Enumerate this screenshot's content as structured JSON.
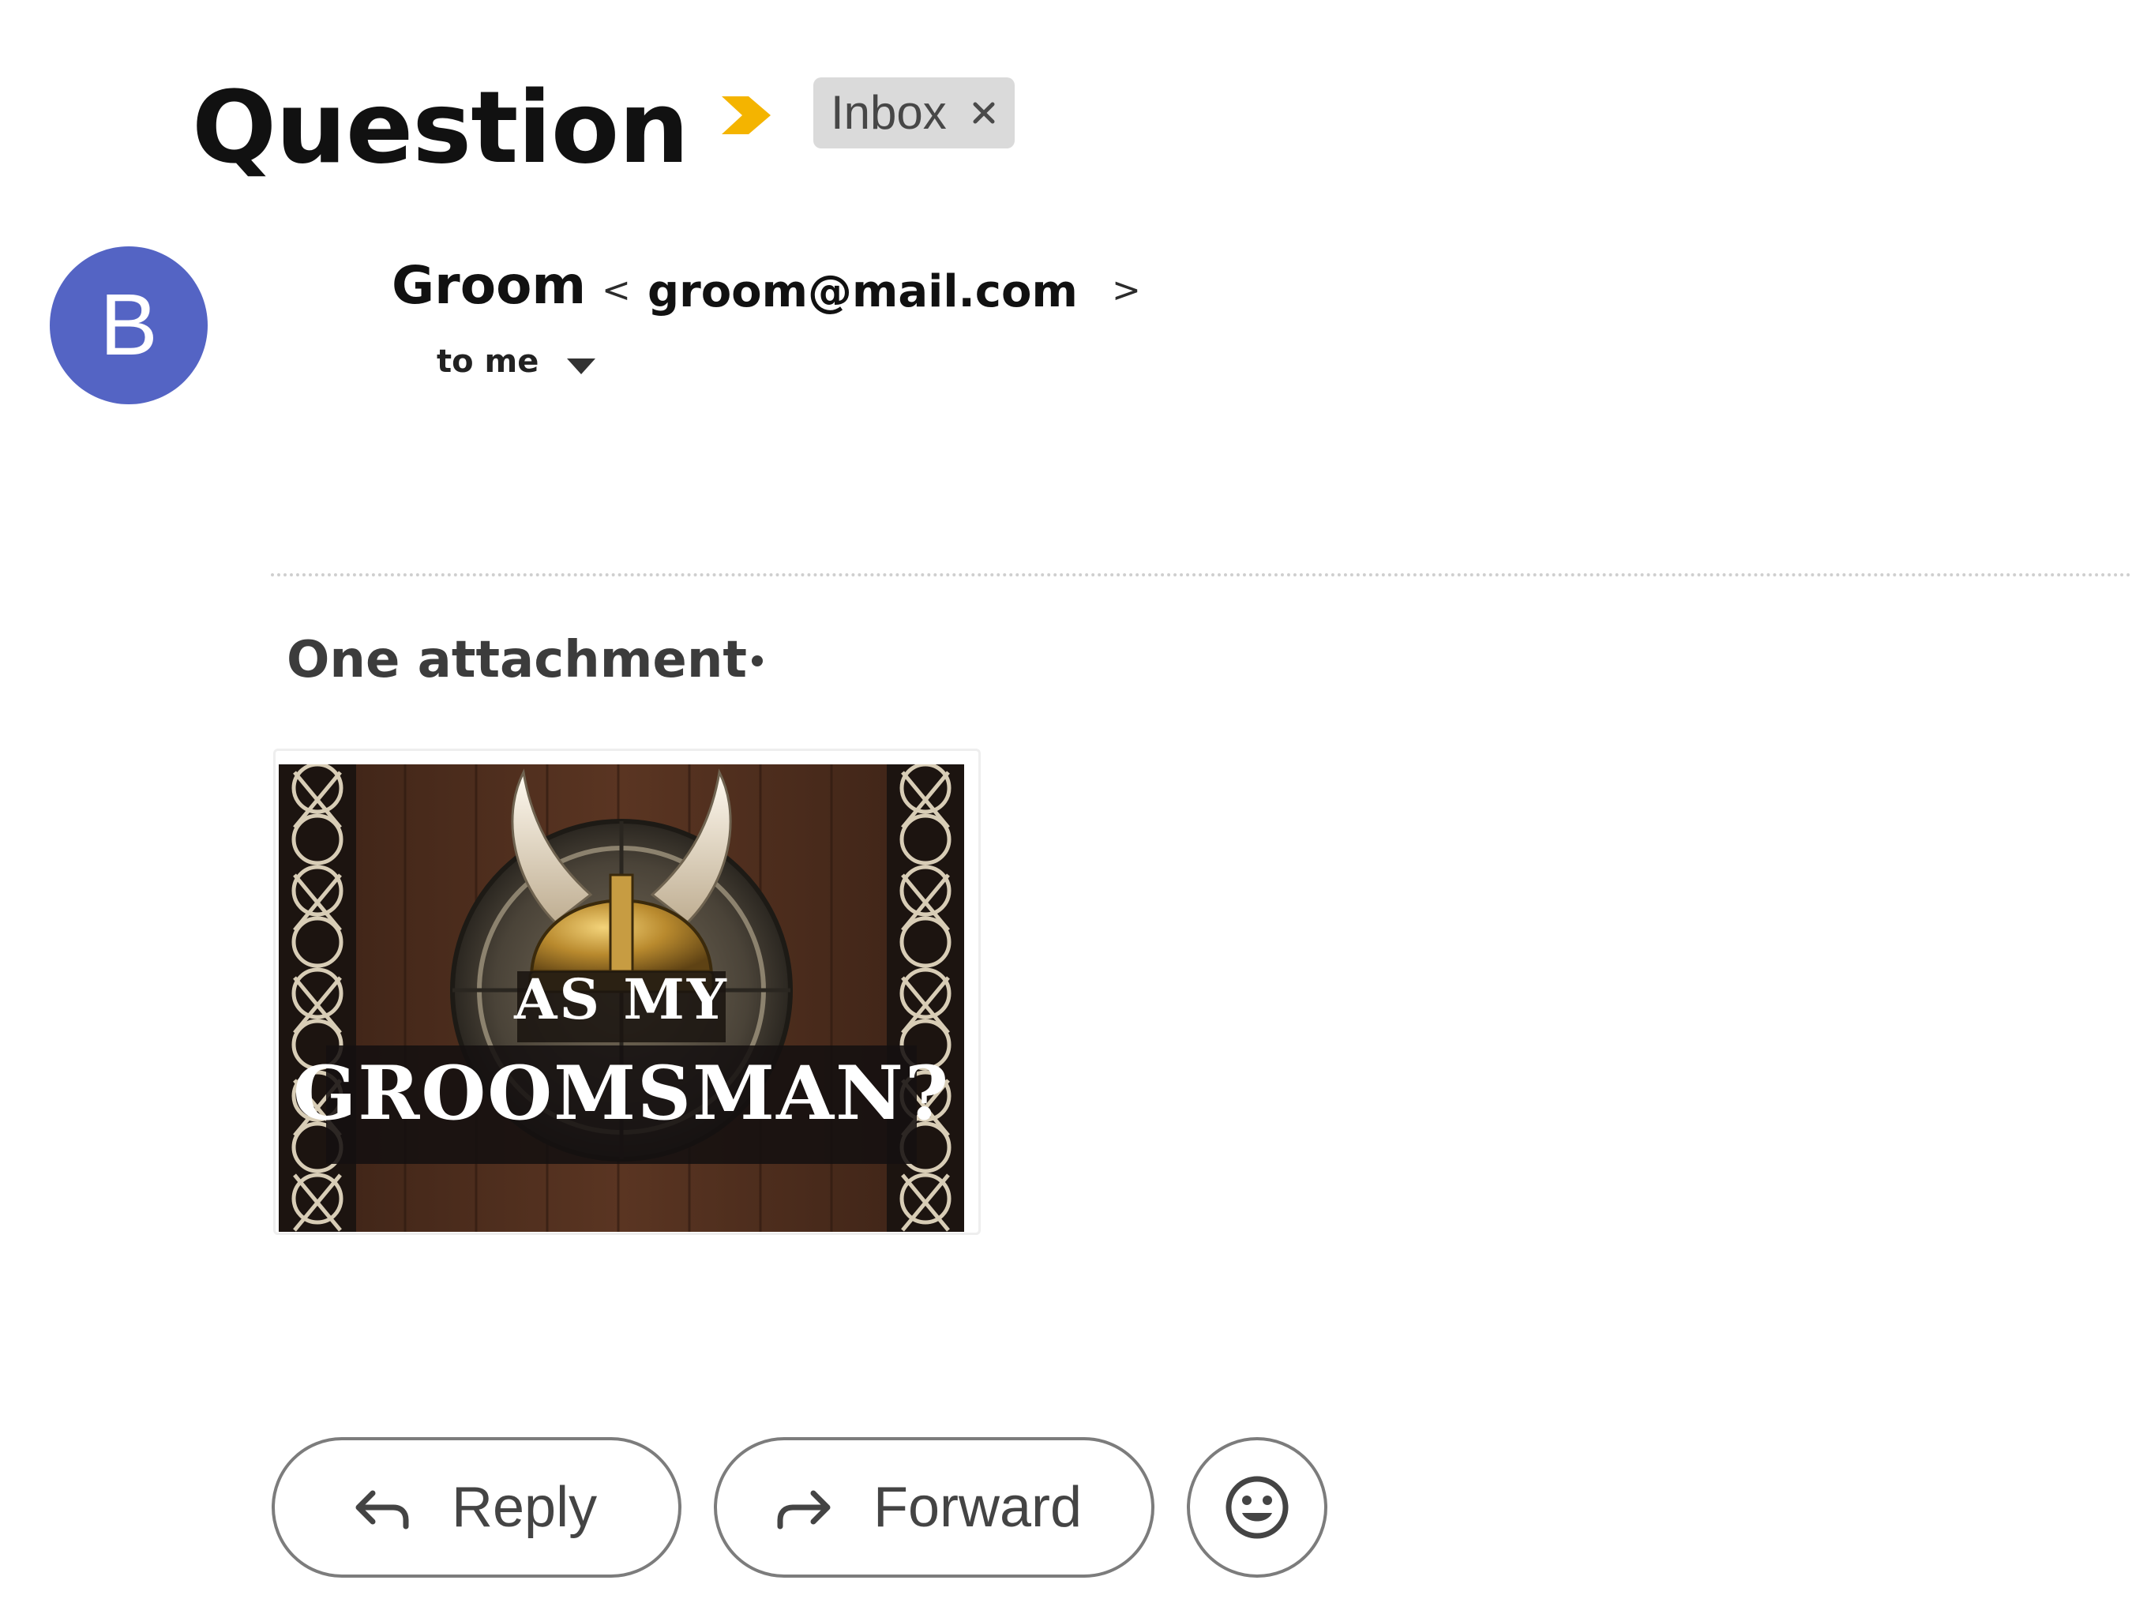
{
  "email": {
    "subject": "Question",
    "label": "Inbox",
    "importance_icon": "importance-arrow-icon",
    "accent_color": "#f4b400"
  },
  "sender": {
    "avatar_letter": "B",
    "avatar_color": "#5464c4",
    "name": "Groom",
    "angle_open": "<",
    "email": "groom@mail.com",
    "angle_close": ">",
    "recipient": "to me"
  },
  "attachments": {
    "header": "One attachment",
    "separator": "•",
    "items": [
      {
        "caption_line1": "AS MY",
        "caption_line2": "GROOMSMAN?"
      }
    ]
  },
  "actions": {
    "reply_label": "Reply",
    "forward_label": "Forward",
    "emoji_icon": "emoji-smile-icon"
  }
}
